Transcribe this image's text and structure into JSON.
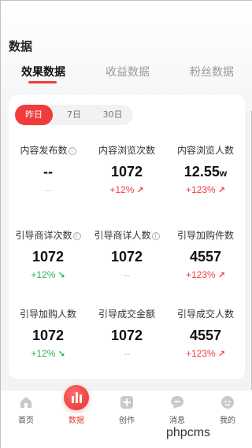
{
  "page": {
    "title": "数据"
  },
  "tabs": [
    {
      "label": "效果数据",
      "active": true
    },
    {
      "label": "收益数据",
      "active": false
    },
    {
      "label": "粉丝数据",
      "active": false
    }
  ],
  "range": [
    {
      "label": "昨日",
      "active": true
    },
    {
      "label": "7日",
      "active": false
    },
    {
      "label": "30日",
      "active": false
    }
  ],
  "metrics": [
    {
      "label": "内容发布数",
      "info": true,
      "value": "--",
      "unit": "",
      "delta": "--",
      "trend": "neutral"
    },
    {
      "label": "内容浏览次数",
      "info": false,
      "value": "1072",
      "unit": "",
      "delta": "+12%",
      "trend": "up"
    },
    {
      "label": "内容浏览人数",
      "info": false,
      "value": "12.55",
      "unit": "w",
      "delta": "+123%",
      "trend": "up"
    },
    {
      "label": "引导商详次数",
      "info": true,
      "value": "1072",
      "unit": "",
      "delta": "+12%",
      "trend": "down"
    },
    {
      "label": "引导商详人数",
      "info": true,
      "value": "1072",
      "unit": "",
      "delta": "--",
      "trend": "neutral"
    },
    {
      "label": "引导加购件数",
      "info": false,
      "value": "4557",
      "unit": "",
      "delta": "+123%",
      "trend": "up"
    },
    {
      "label": "引导加购人数",
      "info": false,
      "value": "1072",
      "unit": "",
      "delta": "+12%",
      "trend": "down"
    },
    {
      "label": "引导成交金额",
      "info": false,
      "value": "1072",
      "unit": "",
      "delta": "--",
      "trend": "neutral"
    },
    {
      "label": "引导成交人数",
      "info": false,
      "value": "4557",
      "unit": "",
      "delta": "+123%",
      "trend": "up"
    }
  ],
  "tabbar": [
    {
      "label": "首页",
      "icon": "home-icon",
      "active": false
    },
    {
      "label": "数据",
      "icon": "chart-icon",
      "active": true
    },
    {
      "label": "创作",
      "icon": "plus-icon",
      "active": false
    },
    {
      "label": "消息",
      "icon": "message-icon",
      "active": false
    },
    {
      "label": "我的",
      "icon": "profile-icon",
      "active": false
    }
  ],
  "watermark": "phpcms",
  "colors": {
    "accent": "#f03c3c",
    "down": "#27b84a",
    "neutral": "#bbbbbb"
  }
}
